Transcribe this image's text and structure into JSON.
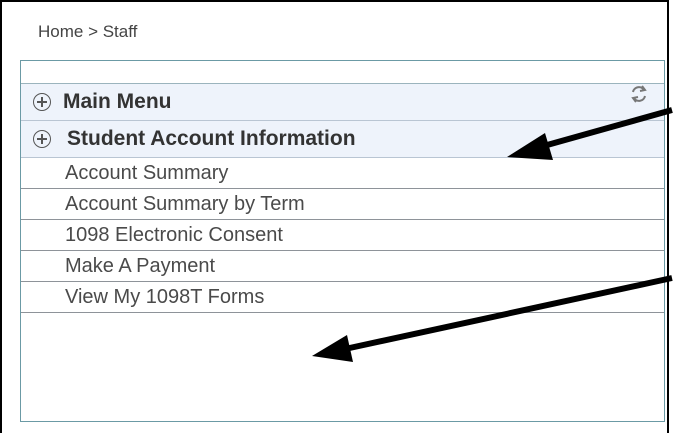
{
  "breadcrumb": "Home > Staff",
  "panel": {
    "headers": [
      {
        "label": "Main Menu"
      },
      {
        "label": "Student Account Information"
      }
    ],
    "items": [
      {
        "label": "Account Summary"
      },
      {
        "label": "Account Summary by Term"
      },
      {
        "label": "1098 Electronic Consent"
      },
      {
        "label": "Make A Payment"
      },
      {
        "label": "View My 1098T Forms"
      }
    ]
  },
  "icons": {
    "expand": "plus-circle-icon",
    "refresh": "refresh-icon",
    "annotation": "arrow-icon"
  },
  "colors": {
    "panel_border": "#6b9aa5",
    "header_bg": "#eef3fb",
    "arrow": "#000000"
  }
}
